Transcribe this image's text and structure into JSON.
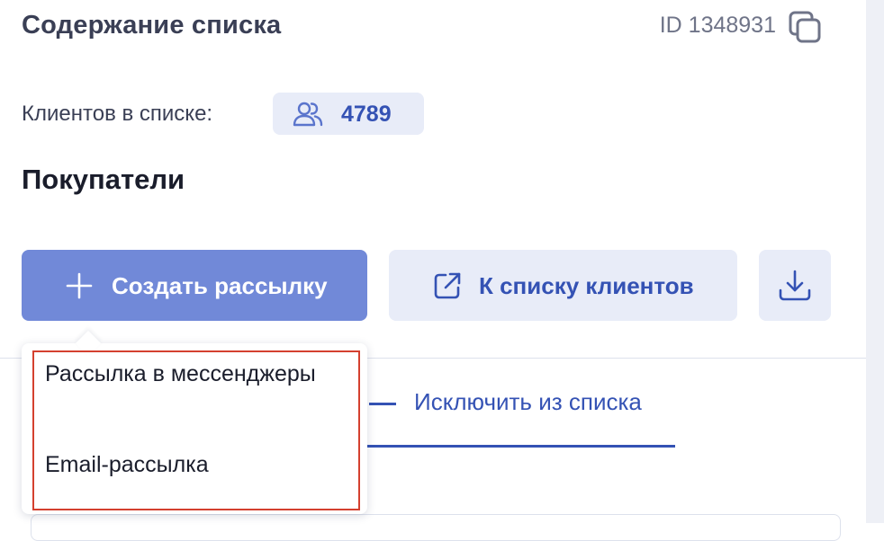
{
  "header": {
    "title": "Содержание списка",
    "list_id": "ID 1348931",
    "copy_icon": "copy-icon"
  },
  "clients": {
    "label": "Клиентов в списке:",
    "count": "4789",
    "icon": "users-icon"
  },
  "section": {
    "title": "Покупатели"
  },
  "actions": {
    "create_mailing": "Создать рассылку",
    "to_client_list": "К списку клиентов",
    "download_icon": "download-icon"
  },
  "dropdown": {
    "items": [
      "Рассылка в мессенджеры",
      "Email-рассылка"
    ]
  },
  "tabs": {
    "exclude": "Исключить из списка"
  },
  "colors": {
    "accent": "#3452b4",
    "primary_button": "#7189d8",
    "soft_background": "#e8ecf8",
    "highlight_border": "#d4402f"
  }
}
